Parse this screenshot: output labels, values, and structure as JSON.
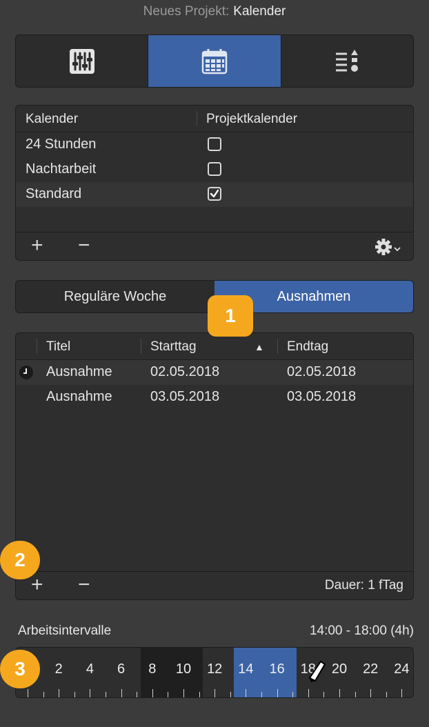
{
  "header": {
    "prefix": "Neues Projekt:",
    "title": "Kalender"
  },
  "top_segments": [
    {
      "icon": "sliders-icon",
      "active": false
    },
    {
      "icon": "calendar-icon",
      "active": true
    },
    {
      "icon": "list-sort-icon",
      "active": false
    }
  ],
  "calendar_table": {
    "columns": [
      "Kalender",
      "Projektkalender"
    ],
    "rows": [
      {
        "name": "24 Stunden",
        "checked": false
      },
      {
        "name": "Nachtarbeit",
        "checked": false
      },
      {
        "name": "Standard",
        "checked": true
      }
    ],
    "toolbar": {
      "add": "+",
      "remove": "−",
      "action_icon": "gear-icon"
    }
  },
  "week_segment": {
    "options": [
      "Reguläre Woche",
      "Ausnahmen"
    ],
    "selected": "Ausnahmen"
  },
  "exceptions_table": {
    "columns": [
      "Titel",
      "Starttag",
      "Endtag"
    ],
    "sort_column": "Starttag",
    "sort_indicator": "▲",
    "rows": [
      {
        "title": "Ausnahme",
        "start": "02.05.2018",
        "end": "02.05.2018",
        "icon": "clock-icon"
      },
      {
        "title": "Ausnahme",
        "start": "03.05.2018",
        "end": "03.05.2018",
        "icon": ""
      }
    ],
    "toolbar": {
      "add": "+",
      "remove": "−",
      "duration": "Dauer: 1 fTag"
    }
  },
  "callouts": [
    "1",
    "2",
    "3"
  ],
  "intervals": {
    "label": "Arbeitsintervalle",
    "range": "14:00 - 18:00 (4h)",
    "hours": [
      "2",
      "4",
      "6",
      "8",
      "10",
      "12",
      "14",
      "16",
      "18",
      "20",
      "22",
      "24"
    ],
    "selected_start_hour": 14,
    "selected_end_hour": 18,
    "dark_start_hour": 8,
    "dark_end_hour": 12
  },
  "colors": {
    "accent": "#3c63a5",
    "callout": "#f5a81d",
    "background": "#3b3b3b"
  }
}
